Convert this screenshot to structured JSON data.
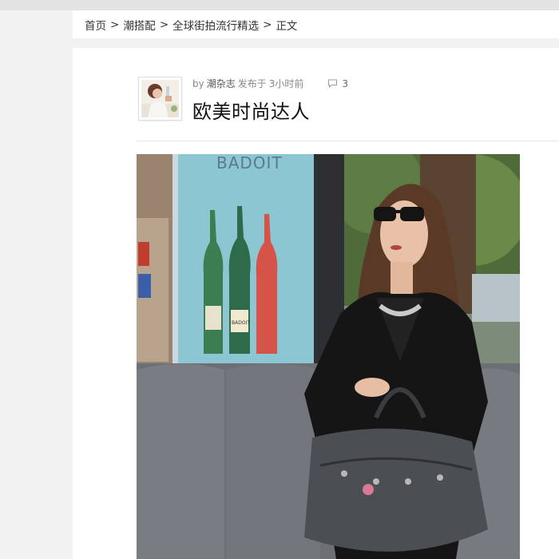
{
  "breadcrumb": {
    "items": [
      "首页",
      "潮搭配",
      "全球街拍流行精选",
      "正文"
    ],
    "separator": ">"
  },
  "post": {
    "by_prefix": "by",
    "author": "潮杂志",
    "published_label": "发布于",
    "time_ago": "3小时前",
    "comment_count": "3",
    "title": "欧美时尚达人"
  },
  "photo": {
    "billboard_brand": "BADOIT",
    "bottle_label": "BADOIT"
  },
  "icons": {
    "comment": "comment-bubble-icon"
  },
  "colors": {
    "page_background": "#f2f2f2",
    "panel_background": "#ffffff",
    "meta_text": "#888888",
    "title_text": "#111111"
  }
}
